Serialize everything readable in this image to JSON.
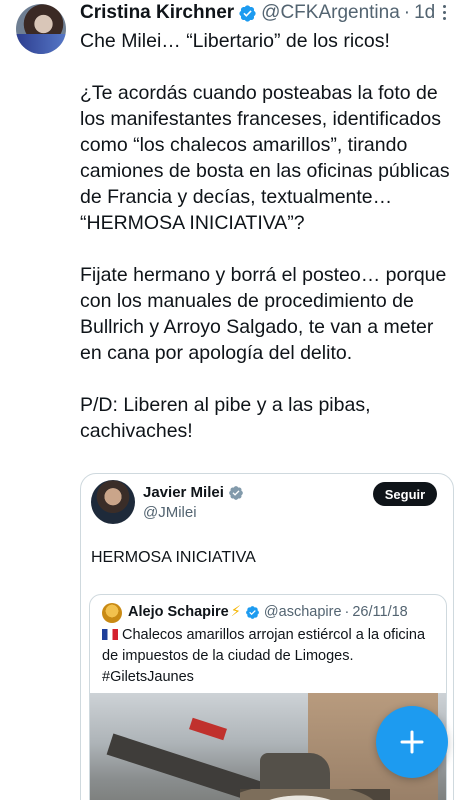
{
  "tweet": {
    "author_name": "Cristina Kirchner",
    "author_handle": "@CFKArgentina",
    "separator": "·",
    "time": "1d",
    "text": "Che Milei… “Libertario” de los ricos!\n\n¿Te acordás cuando posteabas la foto de los manifestantes franceses, identificados como “los chalecos amarillos”, tirando camiones de bosta en las oficinas públicas de Francia y decías, textualmente… “HERMOSA INICIATIVA”?\n\nFijate hermano y borrá el posteo… porque con los manuales de procedimiento de Bullrich y Arroyo Salgado, te van a meter en cana por apología del delito.\n\nP/D: Liberen al pibe y a las pibas, cachivaches!"
  },
  "quote": {
    "author_name": "Javier Milei",
    "author_handle": "@JMilei",
    "follow_label": "Seguir",
    "text": "HERMOSA INICIATIVA",
    "inner": {
      "author_name": "Alejo Schapire",
      "bolt": "⚡",
      "author_handle": "@aschapire",
      "separator": "·",
      "date": "26/11/18",
      "text": "Chalecos amarillos arrojan estiércol a la oficina de impuestos de la ciudad de Limoges. #GiletsJaunes"
    }
  },
  "colors": {
    "accent": "#1d9bf0",
    "text_primary": "#0f1419",
    "text_secondary": "#536471",
    "border": "#cfd9de"
  },
  "icons": {
    "verified": "verified-badge-icon",
    "more": "more-options-icon",
    "compose": "plus-icon",
    "flag": "france-flag-icon"
  }
}
